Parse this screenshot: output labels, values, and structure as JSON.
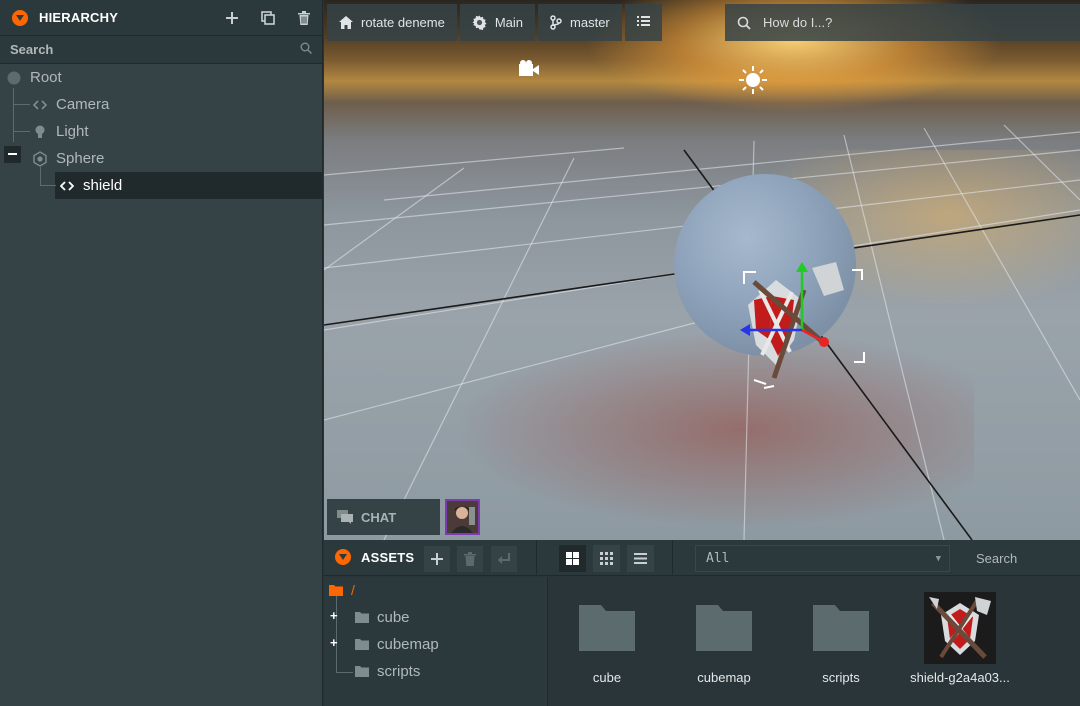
{
  "hierarchy": {
    "title": "HIERARCHY",
    "search_placeholder": "Search",
    "items": [
      {
        "label": "Root"
      },
      {
        "label": "Camera"
      },
      {
        "label": "Light"
      },
      {
        "label": "Sphere"
      },
      {
        "label": "shield"
      }
    ]
  },
  "viewport": {
    "toolbar": {
      "project": "rotate deneme",
      "scene": "Main",
      "branch": "master"
    },
    "help_placeholder": "How do I...?",
    "chat_label": "CHAT"
  },
  "assets": {
    "title": "ASSETS",
    "filter_value": "All",
    "search_placeholder": "Search",
    "tree_root": "/",
    "tree": [
      {
        "label": "cube"
      },
      {
        "label": "cubemap"
      },
      {
        "label": "scripts"
      }
    ],
    "tiles": [
      {
        "label": "cube"
      },
      {
        "label": "cubemap"
      },
      {
        "label": "scripts"
      },
      {
        "label": "shield-g2a4a03..."
      }
    ]
  },
  "colors": {
    "accent": "#fd6600",
    "panel": "#364346",
    "panel_dark": "#2c393c",
    "selected_row": "#20292b",
    "avatar_border": "#7d3bb0"
  }
}
